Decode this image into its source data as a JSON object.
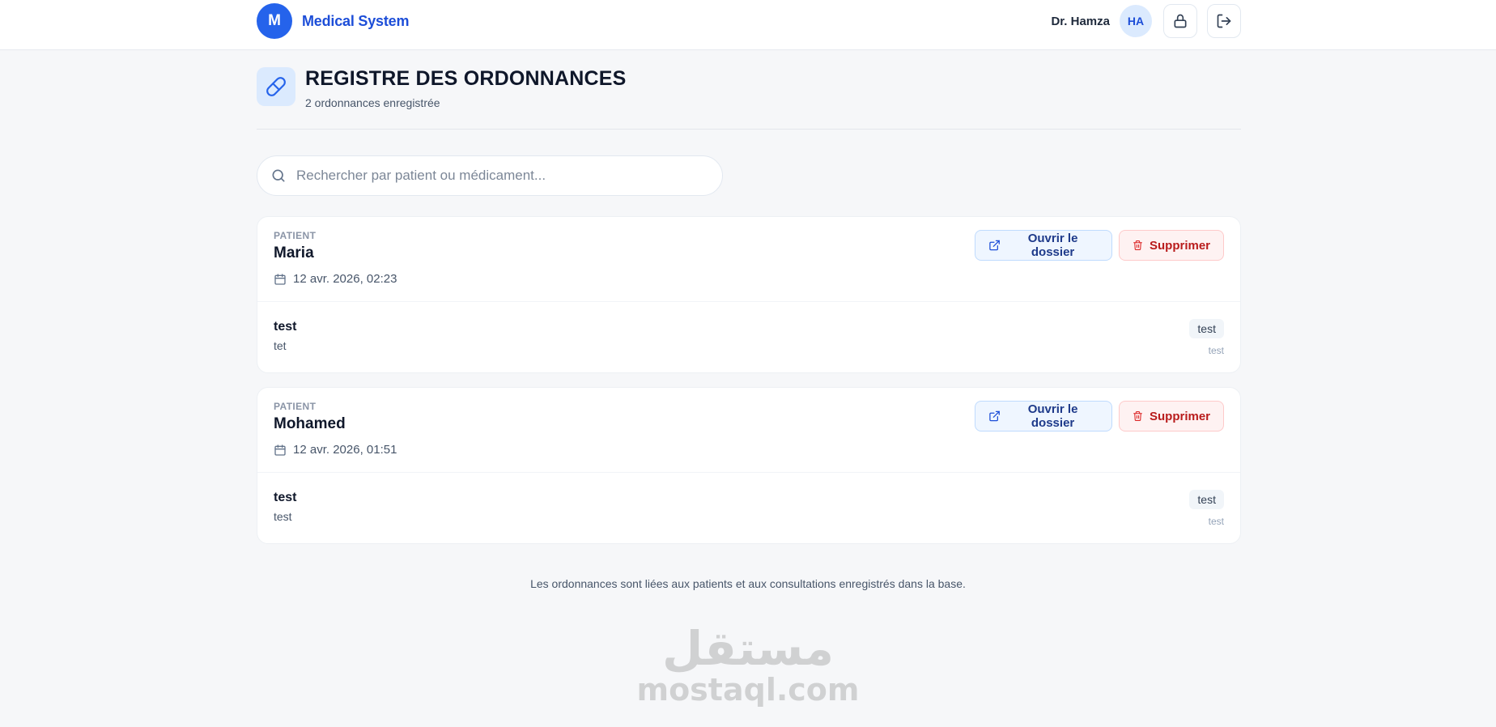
{
  "app": {
    "logo_letter": "M",
    "name": "Medical System"
  },
  "user": {
    "name": "Dr. Hamza",
    "initials": "HA"
  },
  "header": {
    "title": "REGISTRE DES ORDONNANCES",
    "subtitle": "2 ordonnances enregistrée"
  },
  "search": {
    "placeholder": "Rechercher par patient ou médicament...",
    "value": ""
  },
  "prescriptions": [
    {
      "label": "PATIENT",
      "patient": "Maria",
      "date": "12 avr. 2026, 02:23",
      "open_label": "Ouvrir le dossier",
      "delete_label": "Supprimer",
      "medication": {
        "name": "test",
        "detail": "tet",
        "tag": "test",
        "tag_sub": "test"
      }
    },
    {
      "label": "PATIENT",
      "patient": "Mohamed",
      "date": "12 avr. 2026, 01:51",
      "open_label": "Ouvrir le dossier",
      "delete_label": "Supprimer",
      "medication": {
        "name": "test",
        "detail": "test",
        "tag": "test",
        "tag_sub": "test"
      }
    }
  ],
  "footer": {
    "note": "Les ordonnances sont liées aux patients et aux consultations enregistrés dans la base."
  },
  "watermark": {
    "arabic": "مستقل",
    "latin": "mostaql.com"
  },
  "colors": {
    "brand": "#2563eb",
    "danger": "#b91c1c",
    "background": "#f6f7f9"
  }
}
